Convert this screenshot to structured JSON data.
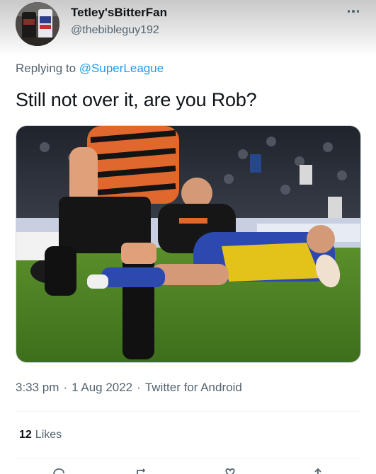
{
  "author": {
    "display_name": "Tetley'sBitterFan",
    "handle": "@thebibleguy192",
    "avatar_icon": "avatar-beer-cans"
  },
  "reply": {
    "prefix": "Replying to",
    "mention": "@SuperLeague"
  },
  "tweet": {
    "text": "Still not over it, are you Rob?",
    "media_description_icon": "rugby-photo"
  },
  "meta": {
    "time": "3:33 pm",
    "date": "1 Aug 2022",
    "source": "Twitter for Android",
    "separator": "·"
  },
  "stats": {
    "likes_count": "12",
    "likes_label": "Likes"
  },
  "actions": [
    "reply-icon",
    "retweet-icon",
    "like-icon",
    "share-icon"
  ],
  "colors": {
    "accent": "#1d9bf0",
    "secondary_text": "#536471",
    "primary_text": "#0f1419"
  }
}
